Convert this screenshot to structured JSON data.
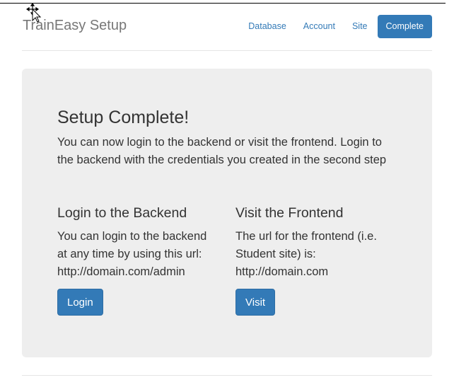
{
  "header": {
    "brand": "TrainEasy Setup",
    "nav": [
      {
        "label": "Database",
        "active": false
      },
      {
        "label": "Account",
        "active": false
      },
      {
        "label": "Site",
        "active": false
      },
      {
        "label": "Complete",
        "active": true
      }
    ]
  },
  "main": {
    "title": "Setup Complete!",
    "lead": "You can now login to the backend or visit the frontend. Login to the backend with the credentials you created in the second step",
    "backend": {
      "heading": "Login to the Backend",
      "line1": "You can login to the backend",
      "line2": "at any time by using this url:",
      "url": "http://domain.com/admin",
      "button": "Login"
    },
    "frontend": {
      "heading": "Visit the Frontend",
      "line1": "The url for the frontend (i.e.",
      "line2": "Student site) is:",
      "url": "http://domain.com",
      "button": "Visit"
    }
  },
  "colors": {
    "primary": "#337ab7",
    "jumbotron_bg": "#eeeeee",
    "brand_text": "#777777"
  },
  "icons": {
    "cursor": "move-cursor-icon"
  }
}
